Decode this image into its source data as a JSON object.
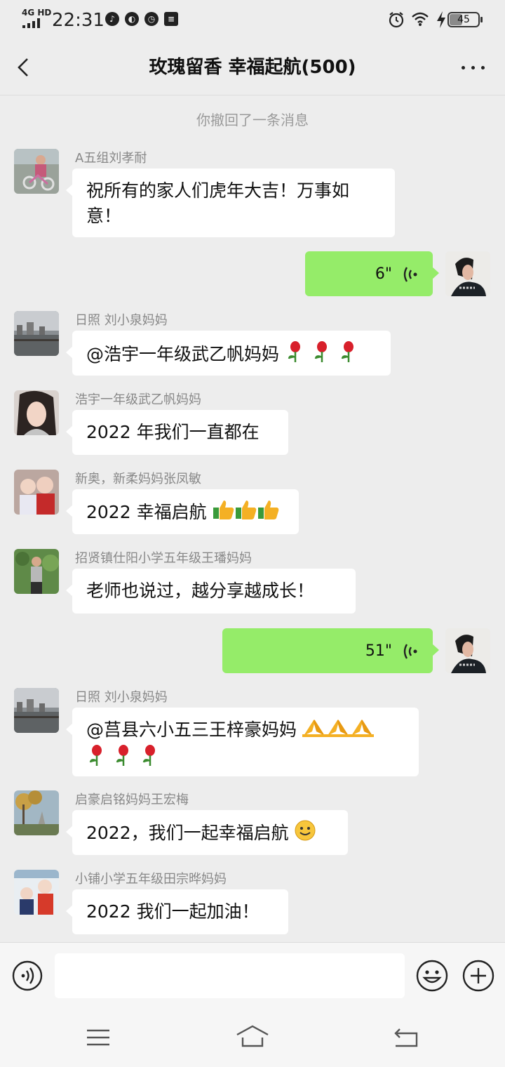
{
  "status_bar": {
    "network": "4G HD",
    "time": "22:31",
    "battery_level": "45",
    "battery_percent": 45
  },
  "header": {
    "title": "玫瑰留香  幸福起航(500)",
    "back_icon": "chevron-left-icon",
    "more_icon": "more-dots-icon"
  },
  "chat": {
    "system_message": "你撤回了一条消息",
    "messages": [
      {
        "sender": "A五组刘孝耐",
        "text": "祝所有的家人们虎年大吉！万事如",
        "text2": "意！"
      },
      {
        "duration": "6\""
      },
      {
        "sender": "日照  刘小泉妈妈",
        "text": "@浩宇一年级武乙帆妈妈 "
      },
      {
        "sender": "浩宇一年级武乙帆妈妈",
        "text": "2022 年我们一直都在"
      },
      {
        "sender": "新奥，新柔妈妈张凤敏",
        "text": "2022 幸福启航"
      },
      {
        "sender": "招贤镇仕阳小学五年级王璠妈妈",
        "text": "老师也说过，越分享越成长！"
      },
      {
        "duration": "51\""
      },
      {
        "sender": "日照  刘小泉妈妈",
        "text": "@莒县六小五三王梓豪妈妈 "
      },
      {
        "sender": "启豪启铭妈妈王宏梅",
        "text": "2022，我们一起幸福启航"
      },
      {
        "sender": "小铺小学五年级田宗晔妈妈",
        "text": "2022 我们一起加油！"
      }
    ]
  },
  "input_bar": {
    "voice_icon": "voice-input-icon",
    "emoji_icon": "emoji-icon",
    "plus_icon": "plus-icon"
  },
  "nav_bar": {
    "icons": [
      "menu-icon",
      "home-icon",
      "back-icon"
    ]
  },
  "colors": {
    "background": "#ededed",
    "bubble_self": "#95ec69",
    "bubble_other": "#ffffff"
  }
}
